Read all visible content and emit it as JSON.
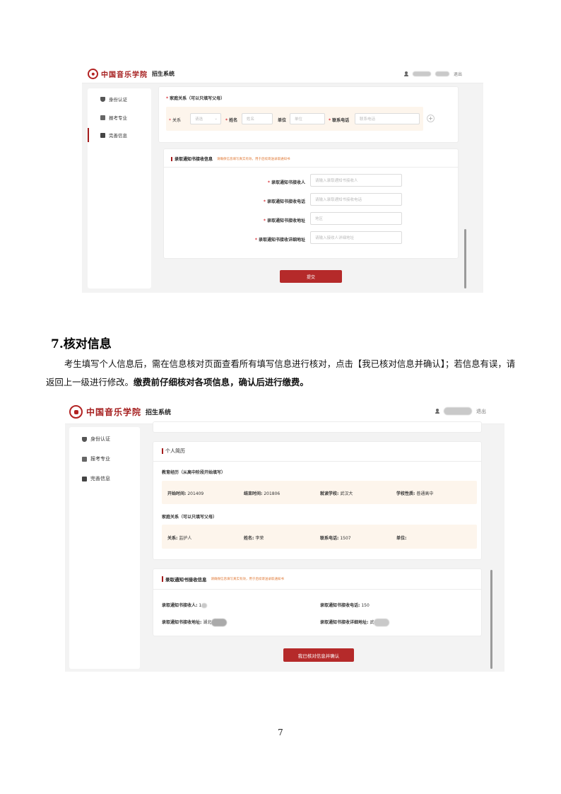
{
  "app": {
    "school_name": "中国音乐学院",
    "system_title": "招生系统",
    "logout": "退出"
  },
  "sidebar": {
    "items": [
      {
        "label": "身份认证",
        "icon": "shield-icon"
      },
      {
        "label": "报考专业",
        "icon": "book-icon"
      },
      {
        "label": "完善信息",
        "icon": "edit-icon"
      }
    ]
  },
  "screen1": {
    "family_section_label": "家庭关系（可以只填写父母）",
    "fields": {
      "relation_label": "关系",
      "relation_placeholder": "请选",
      "name_label": "姓名",
      "name_placeholder": "姓名",
      "unit_label": "单位",
      "unit_placeholder": "单位",
      "phone_label": "联系电话",
      "phone_placeholder": "联系电话"
    },
    "add_button": "+",
    "notice_title": "录取通知书接收信息",
    "notice_hint": "请确保信息填写真实有效，用于后续寄送录取通知书",
    "notice_fields": [
      {
        "label": "录取通知书接收人",
        "placeholder": "请输入录取通知书接收人"
      },
      {
        "label": "录取通知书接收电话",
        "placeholder": "请输入录取通知书接收电话"
      },
      {
        "label": "录取通知书接收地址",
        "placeholder": "地区"
      },
      {
        "label": "录取通知书接收详细地址",
        "placeholder": "请输入接收人详细地址"
      }
    ],
    "submit_button": "提交"
  },
  "doc": {
    "heading": "7.核对信息",
    "para_normal": "考生填写个人信息后，需在信息核对页面查看所有填写信息进行核对，点击【我已核对信息并确认】；若信息有误，请返回上一级进行修改。",
    "para_bold": "缴费前仔细核对各项信息，确认后进行缴费。",
    "page_number": "7"
  },
  "screen2": {
    "resume_title": "个人简历",
    "edu_label": "教育经历（从高中阶段开始填写）",
    "edu_row": [
      {
        "k": "开始时间:",
        "v": "201409"
      },
      {
        "k": "结束时间:",
        "v": "201806"
      },
      {
        "k": "就读学校:",
        "v": "武汉大"
      },
      {
        "k": "学校性质:",
        "v": "普通高中"
      }
    ],
    "family_label": "家庭关系（可以只填写父母）",
    "family_row": [
      {
        "k": "关系:",
        "v": "监护人"
      },
      {
        "k": "姓名:",
        "v": "李荣"
      },
      {
        "k": "联系电话:",
        "v": "1507"
      },
      {
        "k": "单位:",
        "v": ""
      }
    ],
    "notice_title": "录取通知书接收信息",
    "notice_hint": "请确保信息填写真实有效，用于后续寄送录取通知书",
    "notice_rows": [
      {
        "k": "录取通知书接收人:",
        "v": "1"
      },
      {
        "k": "录取通知书接收电话:",
        "v": "150"
      },
      {
        "k": "录取通知书接收地址:",
        "v": "湖北"
      },
      {
        "k": "录取通知书接收详细地址:",
        "v": "武"
      }
    ],
    "confirm_button": "我已核对信息并确认"
  },
  "colors": {
    "brand_red": "#b52a2a",
    "band_bg": "#fdf5ec",
    "hint_orange": "#e07b39"
  }
}
